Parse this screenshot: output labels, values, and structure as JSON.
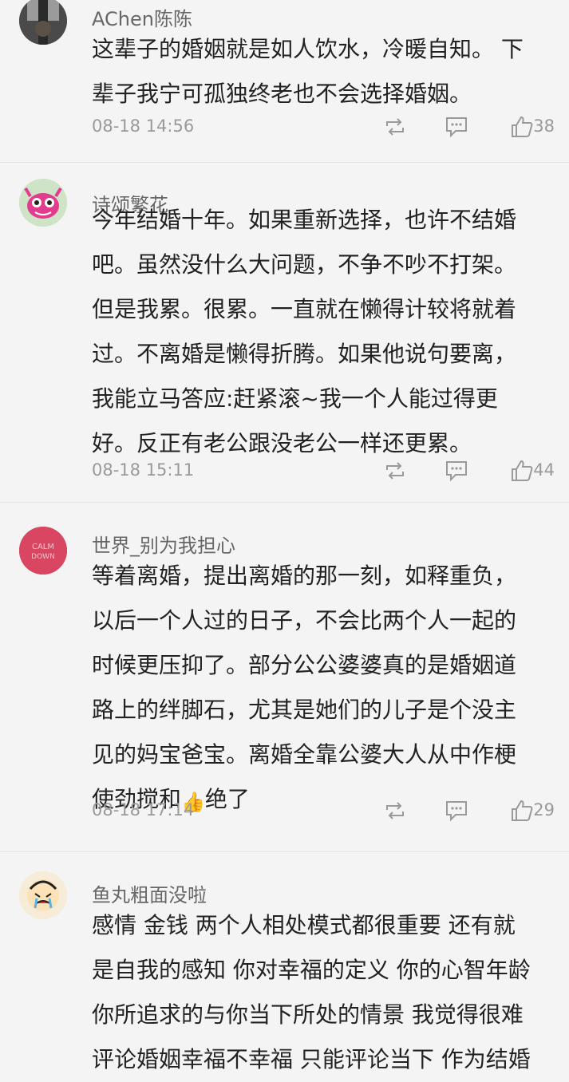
{
  "comments": [
    {
      "username": "AChen陈陈",
      "avatar_icon": "user-photo-avatar",
      "text": "这辈子的婚姻就是如人饮水，冷暖自知。 下\n辈子我宁可孤独终老也不会选择婚姻。",
      "time": "08-18 14:56",
      "likes": "38"
    },
    {
      "username": "诗颂繁花",
      "avatar_icon": "pink-cartoon-avatar",
      "text": "今年结婚十年。如果重新选择，也许不结婚\n吧。虽然没什么大问题，不争不吵不打架。\n但是我累。很累。一直就在懒得计较将就着\n过。不离婚是懒得折腾。如果他说句要离，\n我能立马答应:赶紧滚~我一个人能过得更\n好。反正有老公跟没老公一样还更累。",
      "time": "08-18 15:11",
      "likes": "44"
    },
    {
      "username": "世界_别为我担心",
      "avatar_icon": "calm-down-avatar",
      "avatar_text": "CALM DOWN",
      "text_before_emoji": "等着离婚，提出离婚的那一刻，如释重负，\n以后一个人过的日子，不会比两个人一起的\n时候更压抑了。部分公公婆婆真的是婚姻道\n路上的绊脚石，尤其是她们的儿子是个没主\n见的妈宝爸宝。离婚全靠公婆大人从中作梗\n使劲搅和",
      "emoji": "👍",
      "text_after_emoji": "绝了",
      "time": "08-18 17:14",
      "likes": "29"
    },
    {
      "username": "鱼丸粗面没啦",
      "avatar_icon": "crying-cartoon-avatar",
      "text": "感情 金钱 两个人相处模式都很重要 还有就\n是自我的感知 你对幸福的定义 你的心智年龄\n你所追求的与你当下所处的情景 我觉得很难\n评论婚姻幸福不幸福 只能评论当下 作为结婚"
    }
  ],
  "icons": {
    "repost": "repost-icon",
    "reply": "comment-icon",
    "like": "thumbs-up-icon"
  },
  "colors": {
    "background": "#f4f4f4",
    "text": "#222222",
    "meta": "#9a9a9a"
  }
}
